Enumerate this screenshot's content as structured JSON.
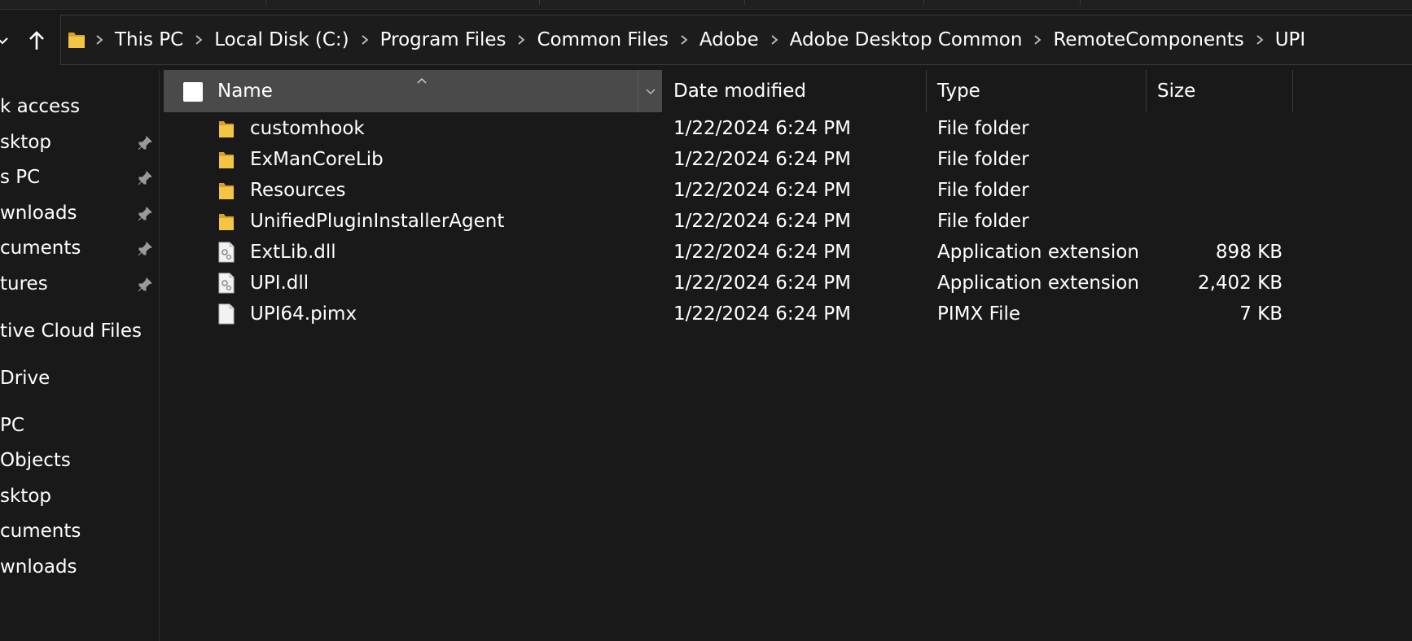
{
  "breadcrumb": [
    "This PC",
    "Local Disk (C:)",
    "Program Files",
    "Common Files",
    "Adobe",
    "Adobe Desktop Common",
    "RemoteComponents",
    "UPI"
  ],
  "sidebar": {
    "items": [
      {
        "label": "k access",
        "pinned": false
      },
      {
        "label": "sktop",
        "pinned": true
      },
      {
        "label": "s PC",
        "pinned": true
      },
      {
        "label": "wnloads",
        "pinned": true
      },
      {
        "label": "cuments",
        "pinned": true
      },
      {
        "label": "tures",
        "pinned": true
      },
      {
        "label": "tive Cloud Files",
        "pinned": false
      },
      {
        "label": "Drive",
        "pinned": false
      },
      {
        "label": "PC",
        "pinned": false
      },
      {
        "label": "Objects",
        "pinned": false
      },
      {
        "label": "sktop",
        "pinned": false
      },
      {
        "label": "cuments",
        "pinned": false
      },
      {
        "label": "wnloads",
        "pinned": false
      }
    ]
  },
  "columns": {
    "name": "Name",
    "date": "Date modified",
    "type": "Type",
    "size": "Size"
  },
  "files": [
    {
      "name": "customhook",
      "date": "1/22/2024 6:24 PM",
      "type": "File folder",
      "size": "",
      "icon": "folder-icon"
    },
    {
      "name": "ExManCoreLib",
      "date": "1/22/2024 6:24 PM",
      "type": "File folder",
      "size": "",
      "icon": "folder-icon"
    },
    {
      "name": "Resources",
      "date": "1/22/2024 6:24 PM",
      "type": "File folder",
      "size": "",
      "icon": "folder-icon"
    },
    {
      "name": "UnifiedPluginInstallerAgent",
      "date": "1/22/2024 6:24 PM",
      "type": "File folder",
      "size": "",
      "icon": "folder-icon"
    },
    {
      "name": "ExtLib.dll",
      "date": "1/22/2024 6:24 PM",
      "type": "Application extension",
      "size": "898 KB",
      "icon": "dll-file-icon"
    },
    {
      "name": "UPI.dll",
      "date": "1/22/2024 6:24 PM",
      "type": "Application extension",
      "size": "2,402 KB",
      "icon": "dll-file-icon"
    },
    {
      "name": "UPI64.pimx",
      "date": "1/22/2024 6:24 PM",
      "type": "PIMX File",
      "size": "7 KB",
      "icon": "file-icon"
    }
  ],
  "colors": {
    "background": "#191919",
    "header_active": "#4a4a4a",
    "folder": "#f4c542",
    "text": "#ffffff"
  }
}
